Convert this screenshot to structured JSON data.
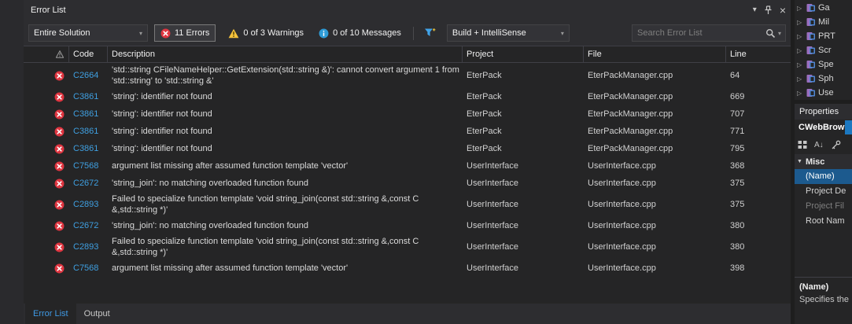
{
  "titlebar": {
    "title": "Error List"
  },
  "toolbar": {
    "scope": "Entire Solution",
    "errors_label": "11 Errors",
    "warnings_label": "0 of 3 Warnings",
    "messages_label": "0 of 10 Messages",
    "filter_combo": "Build + IntelliSense",
    "search_placeholder": "Search Error List"
  },
  "grid": {
    "columns": {
      "code": "Code",
      "description": "Description",
      "project": "Project",
      "file": "File",
      "line": "Line"
    },
    "rows": [
      {
        "severity": "error",
        "code": "C2664",
        "description": "'std::string CFileNameHelper::GetExtension(std::string &)': cannot convert argument 1 from 'std::string' to 'std::string &'",
        "project": "EterPack",
        "file": "EterPackManager.cpp",
        "line": "64"
      },
      {
        "severity": "error",
        "code": "C3861",
        "description": "'string': identifier not found",
        "project": "EterPack",
        "file": "EterPackManager.cpp",
        "line": "669"
      },
      {
        "severity": "error",
        "code": "C3861",
        "description": "'string': identifier not found",
        "project": "EterPack",
        "file": "EterPackManager.cpp",
        "line": "707"
      },
      {
        "severity": "error",
        "code": "C3861",
        "description": "'string': identifier not found",
        "project": "EterPack",
        "file": "EterPackManager.cpp",
        "line": "771"
      },
      {
        "severity": "error",
        "code": "C3861",
        "description": "'string': identifier not found",
        "project": "EterPack",
        "file": "EterPackManager.cpp",
        "line": "795"
      },
      {
        "severity": "error",
        "code": "C7568",
        "description": "argument list missing after assumed function template 'vector'",
        "project": "UserInterface",
        "file": "UserInterface.cpp",
        "line": "368"
      },
      {
        "severity": "error",
        "code": "C2672",
        "description": "'string_join': no matching overloaded function found",
        "project": "UserInterface",
        "file": "UserInterface.cpp",
        "line": "375"
      },
      {
        "severity": "error",
        "code": "C2893",
        "description": "Failed to specialize function template 'void string_join(const std::string &,const C &,std::string *)'",
        "project": "UserInterface",
        "file": "UserInterface.cpp",
        "line": "375"
      },
      {
        "severity": "error",
        "code": "C2672",
        "description": "'string_join': no matching overloaded function found",
        "project": "UserInterface",
        "file": "UserInterface.cpp",
        "line": "380"
      },
      {
        "severity": "error",
        "code": "C2893",
        "description": "Failed to specialize function template 'void string_join(const std::string &,const C &,std::string *)'",
        "project": "UserInterface",
        "file": "UserInterface.cpp",
        "line": "380"
      },
      {
        "severity": "error",
        "code": "C7568",
        "description": "argument list missing after assumed function template 'vector'",
        "project": "UserInterface",
        "file": "UserInterface.cpp",
        "line": "398"
      }
    ]
  },
  "tabs": {
    "error_list": "Error List",
    "output": "Output"
  },
  "sidebar": {
    "tree_items": [
      "Ga",
      "Mil",
      "PRT",
      "Scr",
      "Spe",
      "Sph",
      "Use"
    ],
    "properties": {
      "title": "Properties",
      "object_name": "CWebBrows",
      "category": "Misc",
      "rows": [
        {
          "label": "(Name)",
          "state": "selected"
        },
        {
          "label": "Project De",
          "state": "normal"
        },
        {
          "label": "Project Fil",
          "state": "disabled"
        },
        {
          "label": "Root Nam",
          "state": "normal"
        }
      ],
      "footer_title": "(Name)",
      "footer_description": "Specifies the"
    }
  },
  "colors": {
    "accent": "#007acc",
    "error": "#df3540",
    "warning": "#f6c33c",
    "info": "#2e9bd6",
    "code_link": "#3f9fe0",
    "selection": "#1c5a8e"
  }
}
